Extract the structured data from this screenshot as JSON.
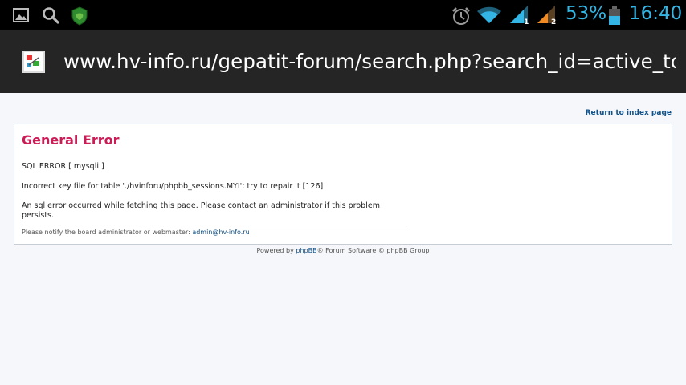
{
  "status_bar": {
    "battery_percent": "53%",
    "time": "16:40",
    "icons": [
      "gallery-icon",
      "search-icon",
      "shield-icon",
      "alarm-icon",
      "wifi-icon",
      "signal-sim1-icon",
      "signal-sim2-icon",
      "battery-icon"
    ],
    "signal1_label": "1",
    "signal2_label": "2"
  },
  "address_bar": {
    "url": "www.hv-info.ru/gepatit-forum/search.php?search_id=active_topics"
  },
  "page": {
    "return_link": "Return to index page",
    "error_title": "General Error",
    "sql_error": "SQL ERROR [ mysqli ]",
    "error_detail": "Incorrect key file for table './hvinforu/phpbb_sessions.MYI'; try to repair it [126]",
    "error_message": "An sql error occurred while fetching this page. Please contact an administrator if this problem persists.",
    "notify_text": "Please notify the board administrator or webmaster: ",
    "admin_email": "admin@hv-info.ru",
    "footer_prefix": "Powered by ",
    "footer_link": "phpBB",
    "footer_suffix": "® Forum Software © phpBB Group"
  },
  "colors": {
    "accent_blue": "#33b5e5",
    "error_title": "#cd1b55",
    "link": "#105289"
  }
}
